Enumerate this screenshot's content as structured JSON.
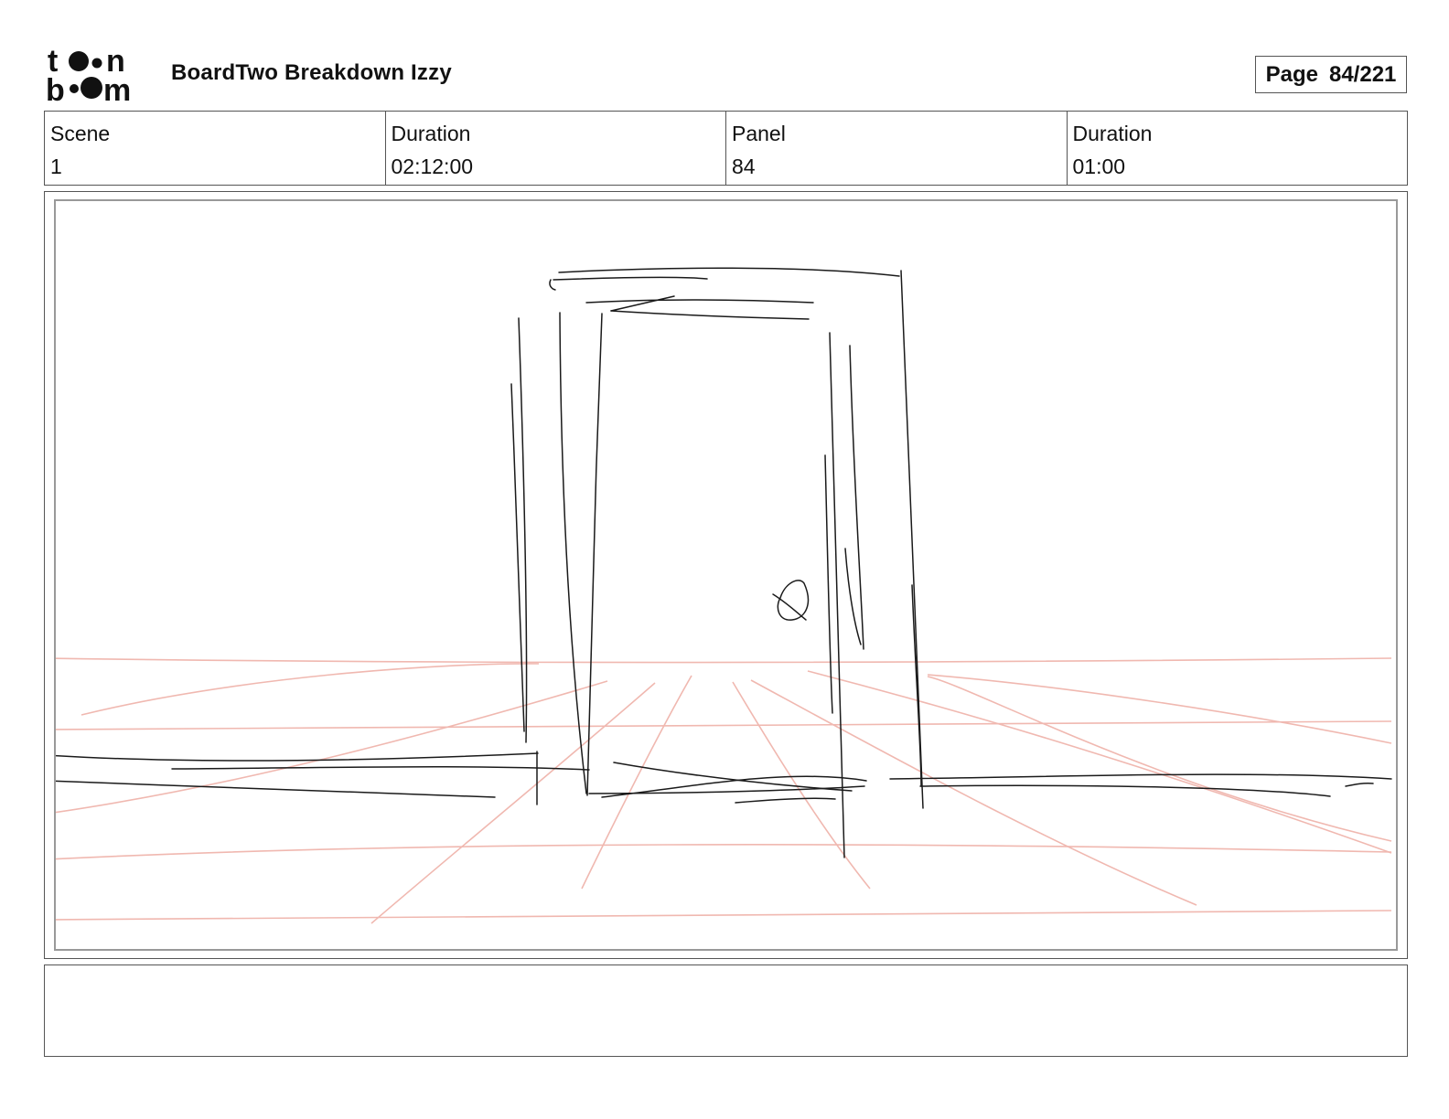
{
  "header": {
    "logo_text": "toon boom",
    "doc_title": "BoardTwo Breakdown Izzy",
    "page_label": "Page",
    "page_number": "84/221"
  },
  "info": [
    {
      "label": "Scene",
      "value": "1"
    },
    {
      "label": "Duration",
      "value": "02:12:00"
    },
    {
      "label": "Panel",
      "value": "84"
    },
    {
      "label": "Duration",
      "value": "01:00"
    }
  ],
  "panel": {
    "sketch_subject": "door-sketch",
    "sketch_color": "#1a1a1a",
    "guide_color": "#f0b8b0"
  },
  "notes": {
    "text": ""
  }
}
